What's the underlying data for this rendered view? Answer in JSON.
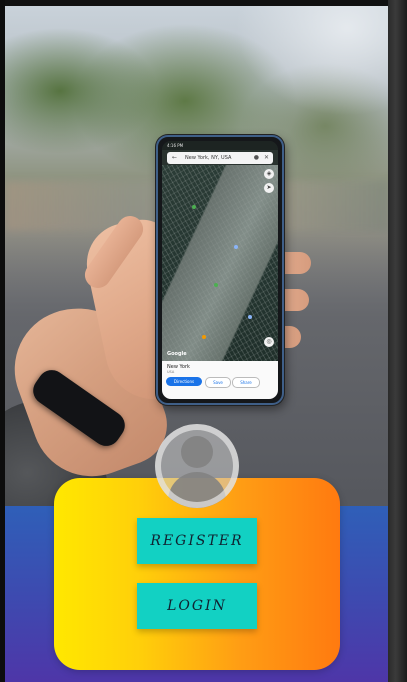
{
  "hero_photo": {
    "phone_screen": {
      "status_time": "4:16 PM",
      "search_text": "New York, NY, USA",
      "map_logo": "Google",
      "place_title": "New York",
      "place_subtitle": "USA",
      "directions_label": "Directions",
      "save_label": "Save",
      "share_label": "Share"
    }
  },
  "auth": {
    "avatar_icon": "user-avatar-icon",
    "register_label": "REGISTER",
    "login_label": "LOGIN"
  },
  "colors": {
    "card_gradient_start": "#ffe800",
    "card_gradient_end": "#ff7a10",
    "button_color": "#12d1c3",
    "bottom_bg_start": "#2f5fb8",
    "bottom_bg_end": "#4e36a8"
  }
}
